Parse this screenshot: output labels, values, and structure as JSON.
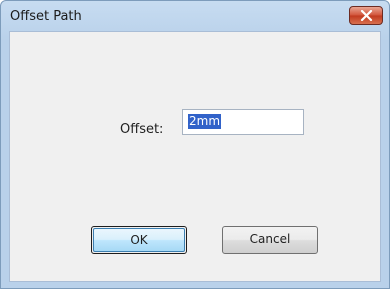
{
  "window": {
    "title": "Offset Path"
  },
  "form": {
    "offset_label": "Offset:",
    "offset_value": "2mm"
  },
  "buttons": {
    "ok_label": "OK",
    "cancel_label": "Cancel"
  },
  "icons": {
    "close": "close-icon"
  },
  "colors": {
    "title_gradient": "#b9d1ea",
    "close_button": "#c13a1f",
    "selection": "#3162c9",
    "dialog_background": "#f0f0f0"
  }
}
